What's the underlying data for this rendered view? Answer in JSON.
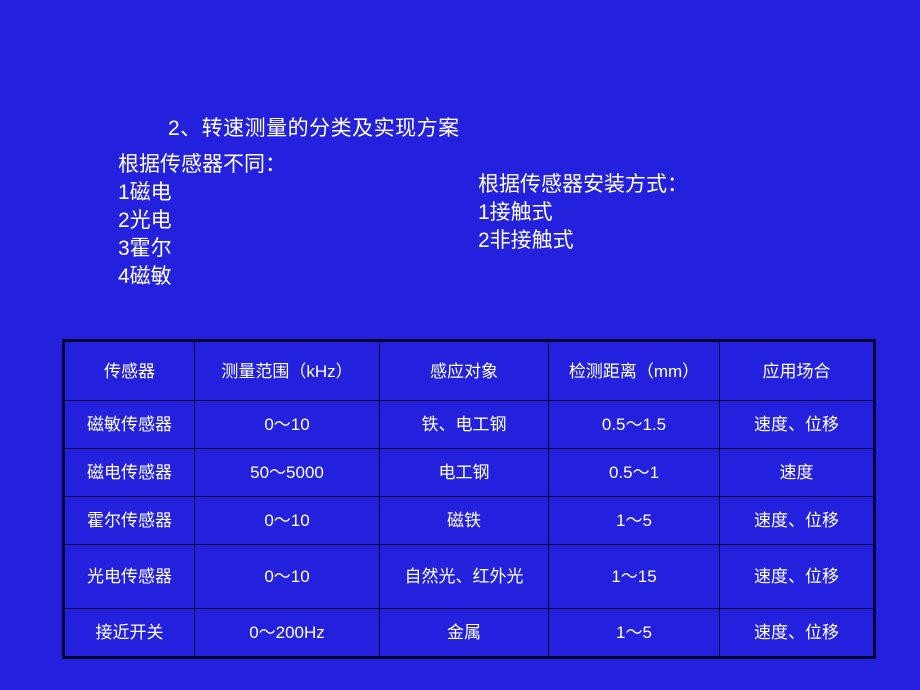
{
  "slide": {
    "background_color": "#2321DE",
    "text_color": "#FFFFFF",
    "table_border_color": "#000033",
    "title": "2、转速测量的分类及实现方案"
  },
  "sensor_type_block": {
    "heading": "根据传感器不同：",
    "items": [
      "1磁电",
      "2光电",
      "3霍尔",
      "4磁敏"
    ]
  },
  "mounting_type_block": {
    "heading": "根据传感器安装方式：",
    "items": [
      "1接触式",
      "2非接触式"
    ]
  },
  "table": {
    "headers": [
      "传感器",
      "测量范围（kHz）",
      "感应对象",
      "检测距离（mm）",
      "应用场合"
    ],
    "rows": [
      [
        "磁敏传感器",
        "0～10",
        "铁、电工钢",
        "0.5～1.5",
        "速度、位移"
      ],
      [
        "磁电传感器",
        "50～5000",
        "电工钢",
        "0.5～1",
        "速度"
      ],
      [
        "霍尔传感器",
        "0～10",
        "磁铁",
        "1～5",
        "速度、位移"
      ],
      [
        "光电传感器",
        "0～10",
        "自然光、红外光",
        "1～15",
        "速度、位移"
      ],
      [
        "接近开关",
        "0～200Hz",
        "金属",
        "1～5",
        "速度、位移"
      ]
    ]
  }
}
